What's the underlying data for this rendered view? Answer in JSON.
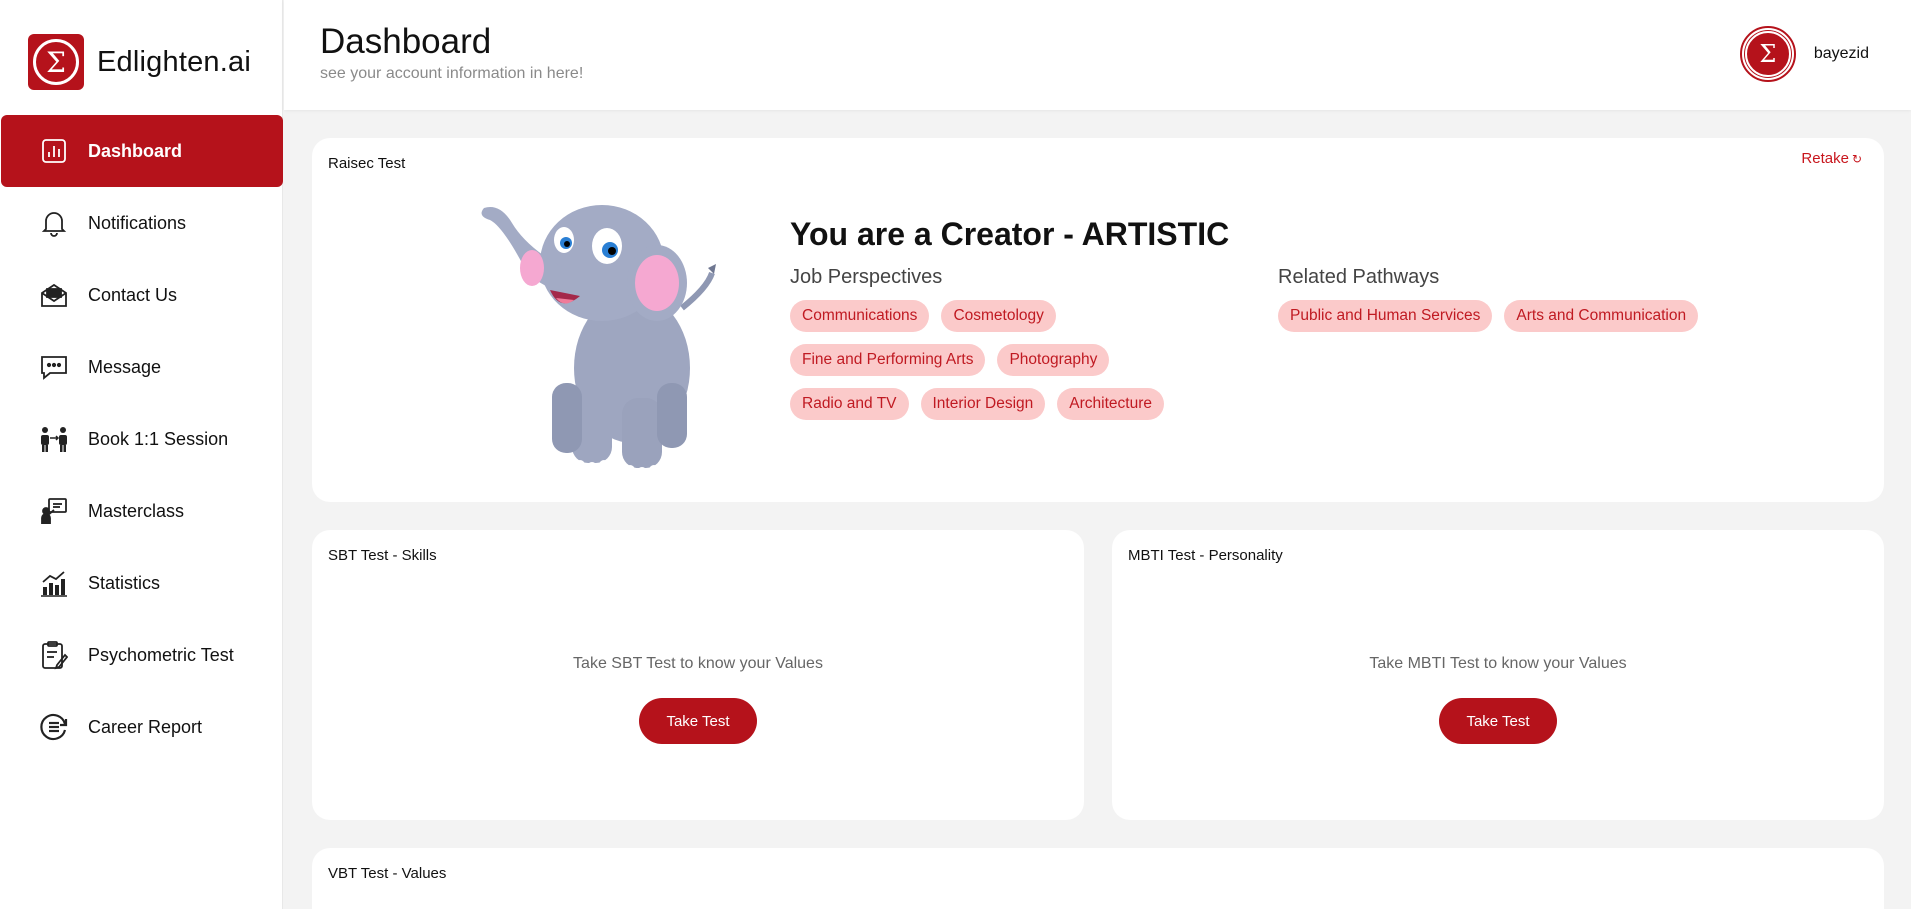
{
  "brand": {
    "name": "Edlighten.ai",
    "logo_icon": "sigma-logo-icon",
    "color": "#b5121b"
  },
  "sidebar": {
    "items": [
      {
        "label": "Dashboard",
        "icon": "chart-icon",
        "active": true
      },
      {
        "label": "Notifications",
        "icon": "bell-icon"
      },
      {
        "label": "Contact Us",
        "icon": "mail-icon"
      },
      {
        "label": "Message",
        "icon": "message-icon"
      },
      {
        "label": "Book 1:1 Session",
        "icon": "people-icon"
      },
      {
        "label": "Masterclass",
        "icon": "presentation-icon"
      },
      {
        "label": "Statistics",
        "icon": "bar-chart-icon"
      },
      {
        "label": "Psychometric Test",
        "icon": "clipboard-icon"
      },
      {
        "label": "Career Report",
        "icon": "report-icon"
      }
    ]
  },
  "header": {
    "title": "Dashboard",
    "subtitle": "see your account information in here!",
    "username": "bayezid"
  },
  "raisec": {
    "title": "Raisec Test",
    "retake_label": "Retake",
    "result": "You are a Creator - ARTISTIC",
    "job_heading": "Job Perspectives",
    "jobs": [
      "Communications",
      "Cosmetology",
      "Fine and Performing Arts",
      "Photography",
      "Radio and TV",
      "Interior Design",
      "Architecture"
    ],
    "pathways_heading": "Related Pathways",
    "pathways": [
      "Public and Human Services",
      "Arts and Communication"
    ]
  },
  "sbt": {
    "title": "SBT Test - Skills",
    "message": "Take SBT Test to know your Values",
    "button": "Take Test"
  },
  "mbti": {
    "title": "MBTI Test - Personality",
    "message": "Take MBTI Test to know your Values",
    "button": "Take Test"
  },
  "vbt": {
    "title": "VBT Test - Values"
  },
  "colors": {
    "accent": "#b5121b",
    "tag_bg": "#fbcaca",
    "tag_text": "#c01a22",
    "background": "#f3f3f3"
  }
}
